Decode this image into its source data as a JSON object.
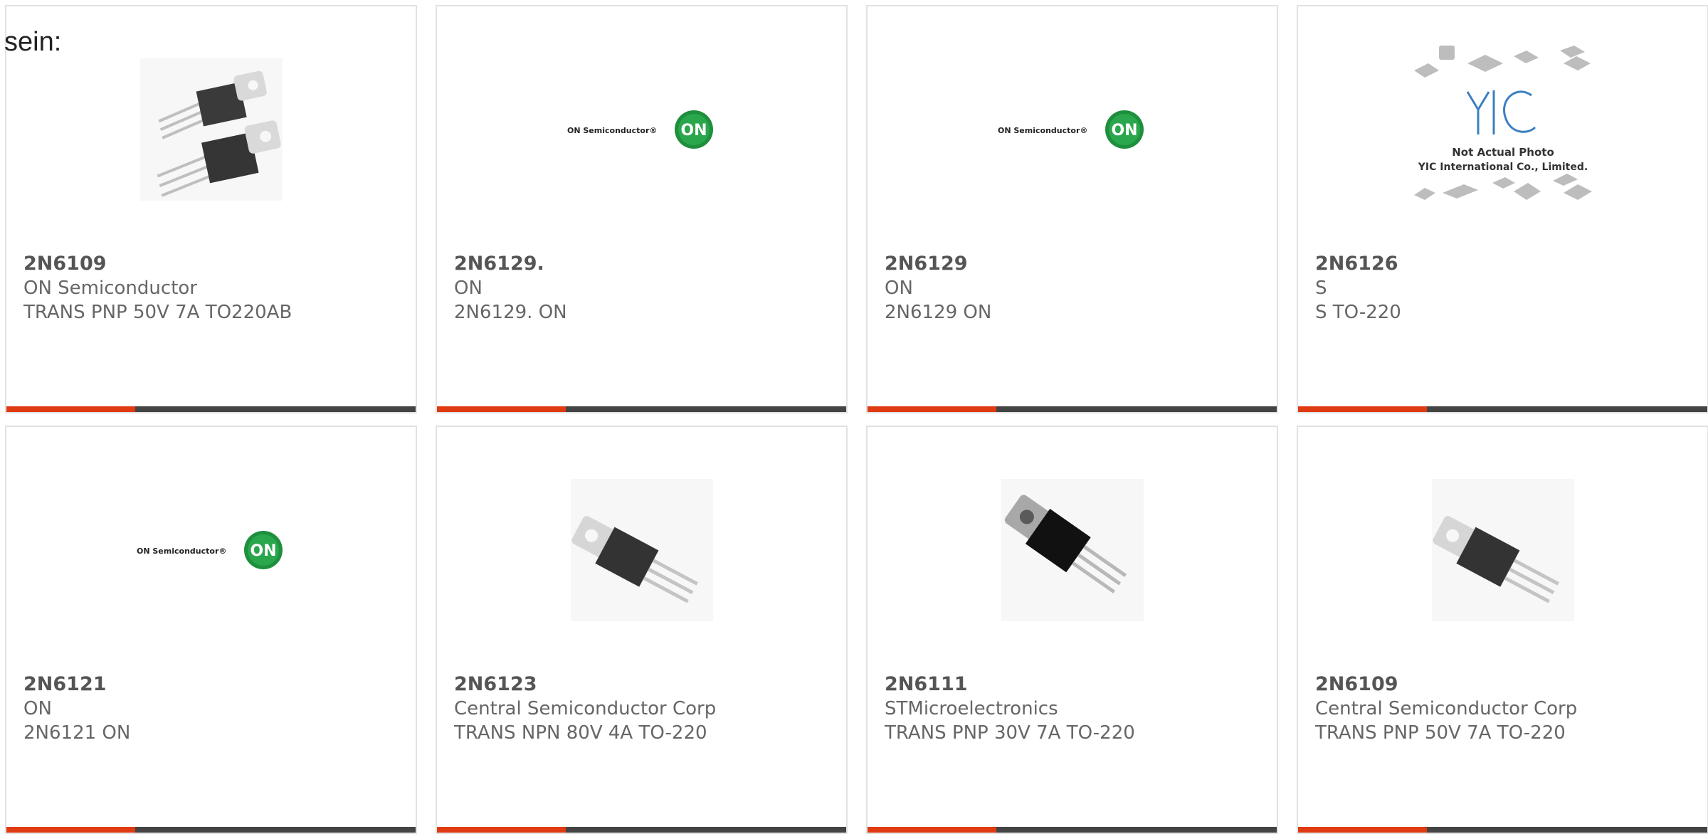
{
  "intro_text": "sein:",
  "colors": {
    "accent": "#e03a12",
    "bar": "#444444",
    "on_logo_green": "#1e8f3c"
  },
  "cards": [
    {
      "part": "2N6109",
      "maker": "ON Semiconductor",
      "desc": "TRANS PNP 50V 7A TO220AB",
      "image": "to220-pair-photo"
    },
    {
      "part": "2N6129.",
      "maker": "ON",
      "desc": "2N6129. ON",
      "image": "on-semiconductor-logo",
      "logo_text": "ON Semiconductor®",
      "logo_badge": "ON"
    },
    {
      "part": "2N6129",
      "maker": "ON",
      "desc": "2N6129 ON",
      "image": "on-semiconductor-logo",
      "logo_text": "ON Semiconductor®",
      "logo_badge": "ON"
    },
    {
      "part": "2N6126",
      "maker": "S",
      "desc": "S TO-220",
      "image": "yic-placeholder",
      "yic_line1": "Not Actual Photo",
      "yic_line2": "YIC International Co., Limited."
    },
    {
      "part": "2N6121",
      "maker": "ON",
      "desc": "2N6121 ON",
      "image": "on-semiconductor-logo",
      "logo_text": "ON Semiconductor®",
      "logo_badge": "ON"
    },
    {
      "part": "2N6123",
      "maker": "Central Semiconductor Corp",
      "desc": "TRANS NPN 80V 4A TO-220",
      "image": "to220-photo"
    },
    {
      "part": "2N6111",
      "maker": "STMicroelectronics",
      "desc": "TRANS PNP 30V 7A TO-220",
      "image": "to220-photo-st"
    },
    {
      "part": "2N6109",
      "maker": "Central Semiconductor Corp",
      "desc": "TRANS PNP 50V 7A TO-220",
      "image": "to220-photo"
    }
  ]
}
